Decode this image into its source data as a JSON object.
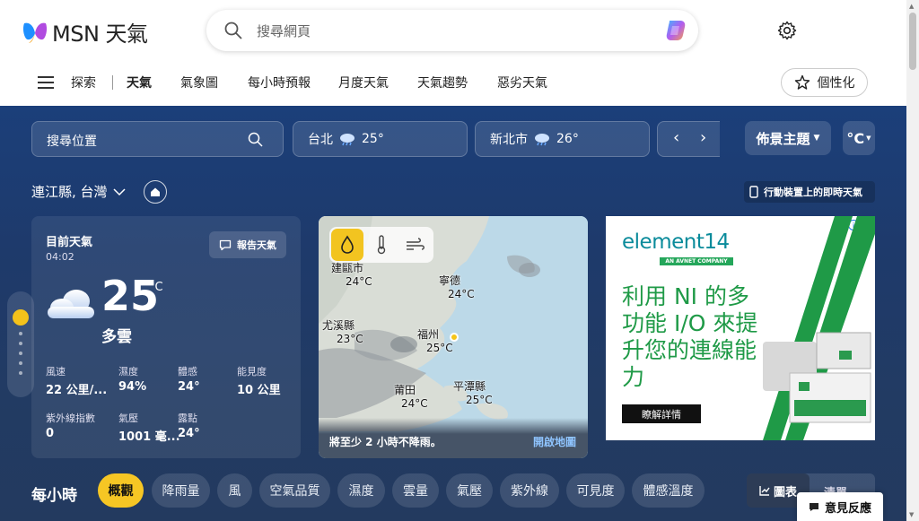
{
  "header": {
    "logo_text": "MSN 天氣",
    "search_placeholder": "搜尋網頁"
  },
  "nav": {
    "items": [
      "探索",
      "天氣",
      "氣象圖",
      "每小時預報",
      "月度天氣",
      "天氣趨勢",
      "惡劣天氣"
    ],
    "active": "天氣",
    "personalize_label": "個性化"
  },
  "toolbar": {
    "location_search_placeholder": "搜尋位置",
    "cities": [
      {
        "name": "台北",
        "temp": "25°",
        "icon": "rain-cloud-icon"
      },
      {
        "name": "新北市",
        "temp": "26°",
        "icon": "rain-cloud-icon"
      }
    ],
    "theme_label": "佈景主題",
    "unit_label": "°C"
  },
  "location": {
    "name": "連江縣, 台灣",
    "mobile_link": "行動裝置上的即時天氣"
  },
  "current": {
    "title": "目前天氣",
    "time": "04:02",
    "report_label": "報告天氣",
    "temperature": "25",
    "unit": "°C",
    "condition": "多雲",
    "stats": [
      {
        "label": "風速",
        "value": "22 公里/..."
      },
      {
        "label": "濕度",
        "value": "94%"
      },
      {
        "label": "體感",
        "value": "24°"
      },
      {
        "label": "能見度",
        "value": "10 公里"
      },
      {
        "label": "紫外線指數",
        "value": "0"
      },
      {
        "label": "氣壓",
        "value": "1001 毫..."
      },
      {
        "label": "露點",
        "value": "24°"
      }
    ]
  },
  "map": {
    "labels": [
      {
        "city": "建甌市",
        "temp": "24°C"
      },
      {
        "city": "寧德",
        "temp": "24°C"
      },
      {
        "city": "尤溪縣",
        "temp": "23°C"
      },
      {
        "city": "福州",
        "temp": "25°C"
      },
      {
        "city": "莆田",
        "temp": "24°C"
      },
      {
        "city": "平潭縣",
        "temp": "25°C"
      }
    ],
    "footer_message": "將至少 2 小時不降雨。",
    "open_map_label": "開啟地圖"
  },
  "ad": {
    "brand": "element14",
    "sub": "AN AVNET COMPANY",
    "headline": "利用 NI 的多功能 I/O 來提升您的連線能力",
    "cta": "瞭解詳情"
  },
  "hourly": {
    "title": "每小時",
    "tabs": [
      "概觀",
      "降雨量",
      "風",
      "空氣品質",
      "濕度",
      "雲量",
      "氣壓",
      "紫外線",
      "可見度",
      "體感溫度"
    ],
    "active": "概觀",
    "view_chart": "圖表",
    "view_list": "清單"
  },
  "feedback_label": "意見反應"
}
